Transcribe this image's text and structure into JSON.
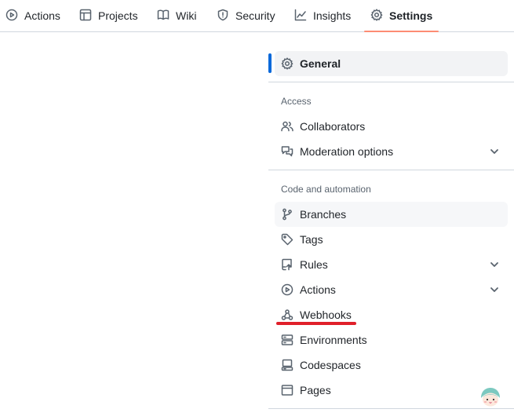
{
  "topnav": {
    "tabs": [
      {
        "label": "Actions",
        "icon": "play-circle-icon"
      },
      {
        "label": "Projects",
        "icon": "table-icon"
      },
      {
        "label": "Wiki",
        "icon": "book-icon"
      },
      {
        "label": "Security",
        "icon": "shield-icon"
      },
      {
        "label": "Insights",
        "icon": "graph-icon"
      },
      {
        "label": "Settings",
        "icon": "gear-icon",
        "active": true
      }
    ],
    "active_underline_color": "#fd8c73"
  },
  "sidebar": {
    "general": {
      "label": "General",
      "icon": "gear-icon",
      "selected": true
    },
    "groups": [
      {
        "title": "Access",
        "items": [
          {
            "label": "Collaborators",
            "icon": "people-icon"
          },
          {
            "label": "Moderation options",
            "icon": "comment-discussion-icon",
            "expandable": true
          }
        ]
      },
      {
        "title": "Code and automation",
        "items": [
          {
            "label": "Branches",
            "icon": "git-branch-icon"
          },
          {
            "label": "Tags",
            "icon": "tag-icon"
          },
          {
            "label": "Rules",
            "icon": "repo-push-icon",
            "expandable": true
          },
          {
            "label": "Actions",
            "icon": "play-circle-icon",
            "expandable": true
          },
          {
            "label": "Webhooks",
            "icon": "webhook-icon"
          },
          {
            "label": "Environments",
            "icon": "server-icon"
          },
          {
            "label": "Codespaces",
            "icon": "codespaces-icon"
          },
          {
            "label": "Pages",
            "icon": "browser-icon"
          }
        ]
      }
    ]
  },
  "colors": {
    "selected_indicator": "#0969da",
    "annotation_underline": "#e0202a"
  }
}
